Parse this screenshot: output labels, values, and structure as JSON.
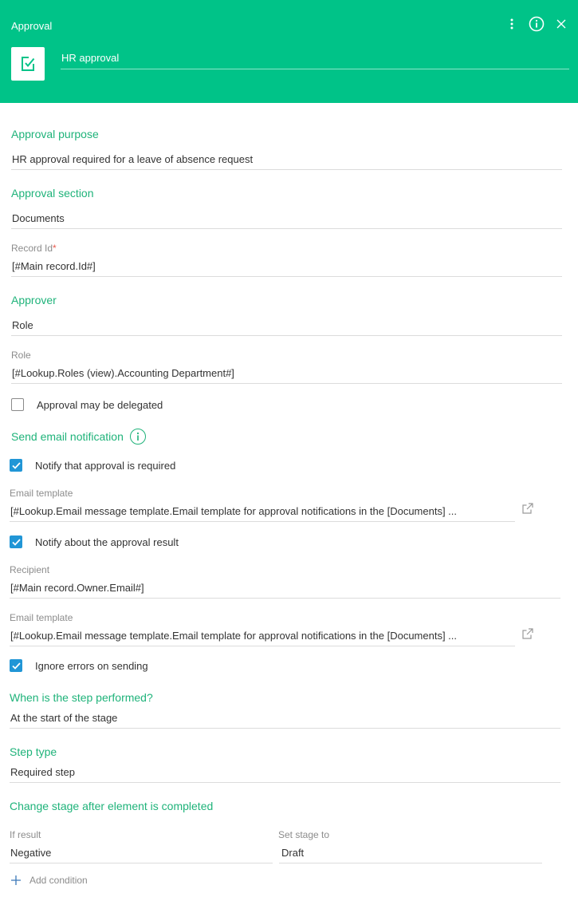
{
  "header": {
    "title": "Approval",
    "element_name": "HR approval"
  },
  "approval_purpose": {
    "label": "Approval purpose",
    "value": "HR approval required for a leave of absence request"
  },
  "approval_section": {
    "label": "Approval section",
    "value": "Documents"
  },
  "record_id": {
    "label": "Record Id",
    "required_mark": "*",
    "value": "[#Main record.Id#]"
  },
  "approver": {
    "label": "Approver",
    "value": "Role"
  },
  "role": {
    "label": "Role",
    "value": "[#Lookup.Roles (view).Accounting Department#]"
  },
  "delegation": {
    "label": "Approval may be delegated",
    "checked": false
  },
  "email_notification": {
    "label": "Send email notification",
    "notify_required": {
      "label": "Notify that approval is required",
      "checked": true
    },
    "template1": {
      "label": "Email template",
      "value": "[#Lookup.Email message template.Email template for approval notifications in the [Documents] ..."
    },
    "notify_result": {
      "label": "Notify about the approval result",
      "checked": true
    },
    "recipient": {
      "label": "Recipient",
      "value": "[#Main record.Owner.Email#]"
    },
    "template2": {
      "label": "Email template",
      "value": "[#Lookup.Email message template.Email template for approval notifications in the [Documents] ..."
    },
    "ignore_errors": {
      "label": "Ignore errors on sending",
      "checked": true
    }
  },
  "when_performed": {
    "label": "When is the step performed?",
    "value": "At the start of the stage"
  },
  "step_type": {
    "label": "Step type",
    "value": "Required step"
  },
  "change_stage": {
    "label": "Change stage after element is completed",
    "if_result_label": "If result",
    "if_result_value": "Negative",
    "set_stage_label": "Set stage to",
    "set_stage_value": "Draft",
    "add_condition_label": "Add condition"
  },
  "colors": {
    "header_bg": "#00c388",
    "section_label": "#1fb37a",
    "checkbox_on": "#2196d6",
    "required_mark": "#e95b4f"
  },
  "icons": {
    "element": "approval-check-icon",
    "menu": "more-vertical-icon",
    "info": "info-icon",
    "close": "close-icon",
    "open_link": "external-link-icon",
    "add": "plus-icon"
  }
}
